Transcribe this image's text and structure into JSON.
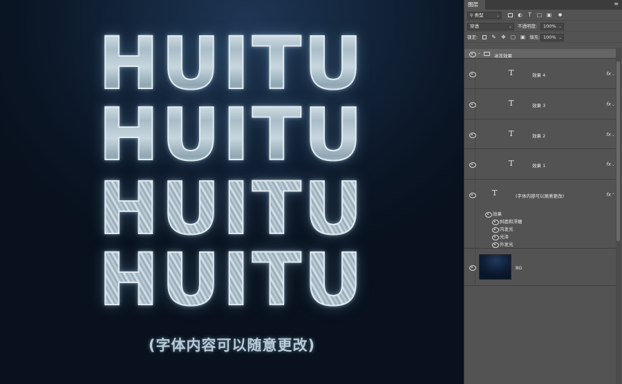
{
  "canvas": {
    "rows": [
      "HUITU",
      "HUITU",
      "HUITU",
      "HUITU"
    ],
    "caption": "(字体内容可以随意更改)"
  },
  "panel": {
    "tab_label": "图层",
    "menu_icon": "≡",
    "filter": {
      "label": "类型",
      "icon": "search-icon"
    },
    "filter_icons": [
      "image-filter-icon",
      "adjustment-filter-icon",
      "type-filter-icon",
      "shape-filter-icon",
      "smart-object-filter-icon",
      "filter-toggle-icon"
    ],
    "blend_mode": "穿透",
    "opacity_label": "不透明度:",
    "opacity_value": "100%",
    "lock_label": "锁定:",
    "lock_icons": [
      "lock-pixels-icon",
      "lock-paint-icon",
      "lock-position-icon",
      "lock-artboard-icon",
      "lock-all-icon"
    ],
    "fill_label": "填充:",
    "fill_value": "100%"
  },
  "layers": {
    "group_name": "冰冻效果",
    "items": [
      {
        "name": "效果 4",
        "fx": "fx"
      },
      {
        "name": "效果 3",
        "fx": "fx"
      },
      {
        "name": "效果 2",
        "fx": "fx"
      },
      {
        "name": "效果 1",
        "fx": "fx"
      },
      {
        "name": "(字体内容可以随意更改)",
        "fx": "fx"
      }
    ],
    "effects_header": "效果",
    "effects": [
      "斜面和浮雕",
      "内发光",
      "光泽",
      "外发光"
    ],
    "background_name": "BG"
  },
  "colors": {
    "panel_bg": "#535353",
    "canvas_bg": "#0b1626",
    "ice_text": "#b3c4ce"
  }
}
